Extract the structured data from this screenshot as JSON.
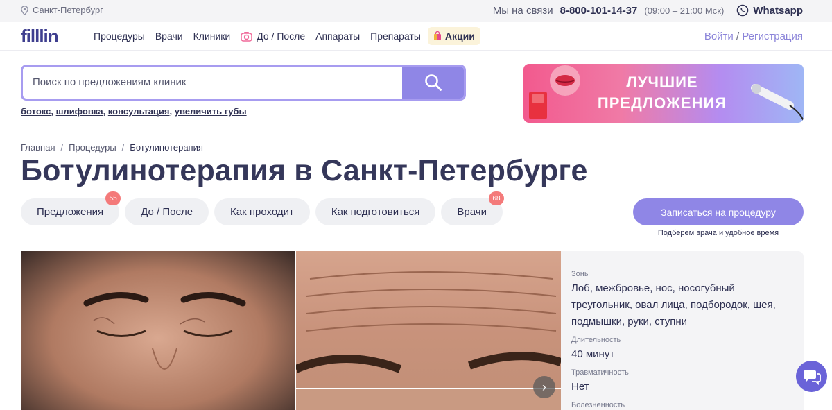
{
  "topbar": {
    "city": "Санкт-Петербург",
    "contact_label": "Мы на связи",
    "phone": "8-800-101-14-37",
    "hours": "(09:00 – 21:00 Мск)",
    "whatsapp": "Whatsapp"
  },
  "nav": {
    "logo": "filllin",
    "items": [
      "Процедуры",
      "Врачи",
      "Клиники",
      "До / После",
      "Аппараты",
      "Препараты"
    ],
    "promo": "Акции",
    "login": "Войти",
    "separator": "/",
    "register": "Регистрация"
  },
  "search": {
    "placeholder": "Поиск по предложениям клиник",
    "hints": [
      "ботокс",
      "шлифовка",
      "консультация",
      "увеличить губы"
    ]
  },
  "banner": {
    "line1": "ЛУЧШИЕ",
    "line2": "ПРЕДЛОЖЕНИЯ"
  },
  "breadcrumbs": [
    "Главная",
    "Процедуры",
    "Ботулинотерапия"
  ],
  "page_title": "Ботулинотерапия в Санкт-Петербурге",
  "tabs": [
    {
      "label": "Предложения",
      "badge": "55"
    },
    {
      "label": "До / После",
      "badge": ""
    },
    {
      "label": "Как проходит",
      "badge": ""
    },
    {
      "label": "Как подготовиться",
      "badge": ""
    },
    {
      "label": "Врачи",
      "badge": "68"
    }
  ],
  "cta": {
    "label": "Записаться на процедуру",
    "sub": "Подберем врача и удобное время"
  },
  "info": {
    "zones_label": "Зоны",
    "zones_value": "Лоб, межбровье, нос, носогубный треугольник, овал лица, подбородок, шея, подмышки, руки, ступни",
    "duration_label": "Длительность",
    "duration_value": "40 минут",
    "trauma_label": "Травматичность",
    "trauma_value": "Нет",
    "pain_label": "Болезненность"
  },
  "gallery": {
    "next_glyph": "›"
  },
  "colors": {
    "accent": "#8f86e6",
    "badge": "#f47a7a",
    "text": "#2e3052"
  }
}
